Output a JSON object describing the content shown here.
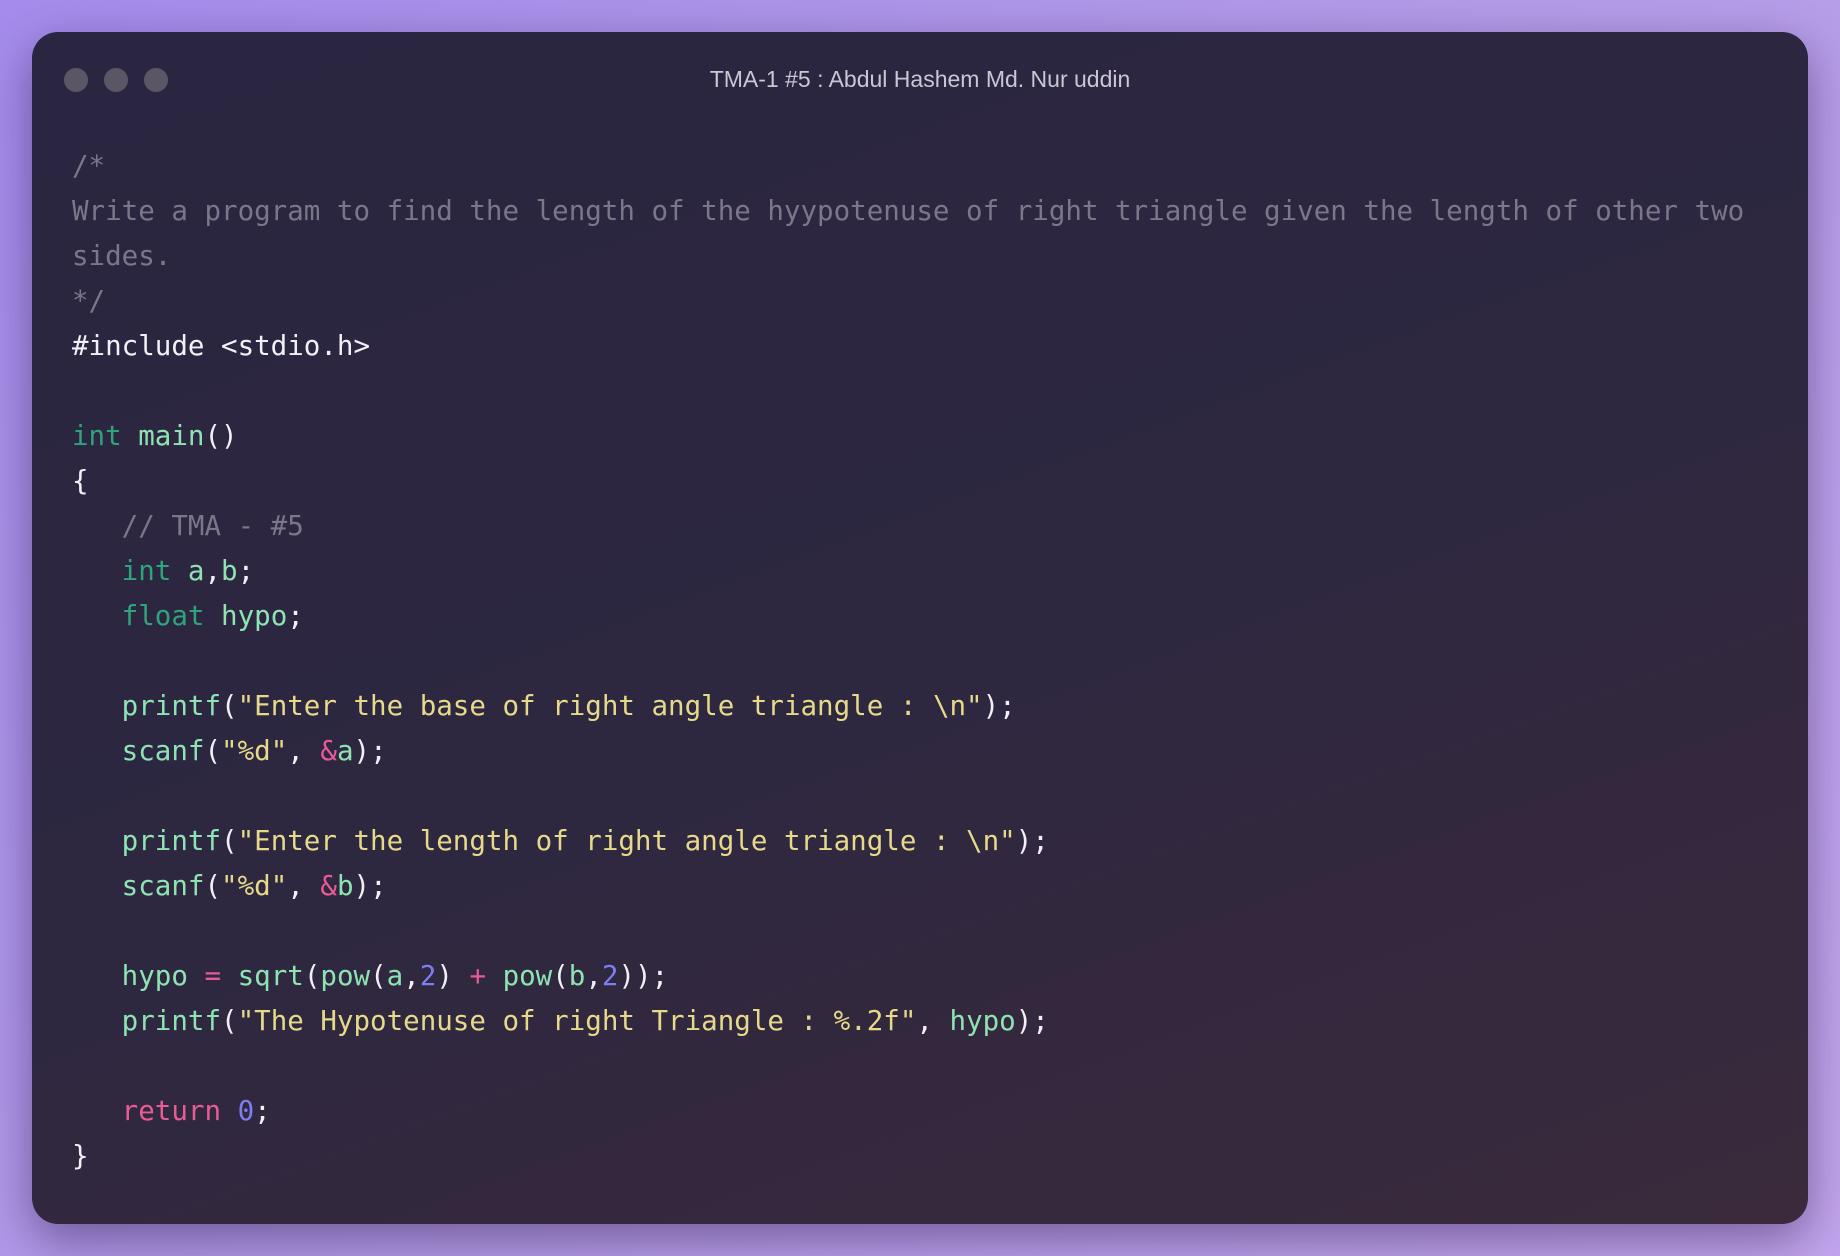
{
  "window": {
    "title": "TMA-1 #5 : Abdul Hashem Md. Nur uddin",
    "dot_color": "#5a5666"
  },
  "code": {
    "lines": [
      [
        {
          "t": "/*",
          "c": "cmt"
        }
      ],
      [
        {
          "t": "Write a program to find the length of the hyypotenuse of right triangle given the length of other two sides.",
          "c": "cmt"
        }
      ],
      [
        {
          "t": "*/",
          "c": "cmt"
        }
      ],
      [
        {
          "t": "#include <stdio.h>",
          "c": "pp"
        }
      ],
      [],
      [
        {
          "t": "int",
          "c": "type"
        },
        {
          "t": " ",
          "c": "punc"
        },
        {
          "t": "main",
          "c": "fn"
        },
        {
          "t": "()",
          "c": "punc"
        }
      ],
      [
        {
          "t": "{",
          "c": "punc"
        }
      ],
      [
        {
          "t": "   // TMA - #5",
          "c": "cmt"
        }
      ],
      [
        {
          "t": "   ",
          "c": "punc"
        },
        {
          "t": "int",
          "c": "type"
        },
        {
          "t": " ",
          "c": "punc"
        },
        {
          "t": "a",
          "c": "var"
        },
        {
          "t": ",",
          "c": "punc"
        },
        {
          "t": "b",
          "c": "var"
        },
        {
          "t": ";",
          "c": "punc"
        }
      ],
      [
        {
          "t": "   ",
          "c": "punc"
        },
        {
          "t": "float",
          "c": "type"
        },
        {
          "t": " ",
          "c": "punc"
        },
        {
          "t": "hypo",
          "c": "var"
        },
        {
          "t": ";",
          "c": "punc"
        }
      ],
      [],
      [
        {
          "t": "   ",
          "c": "punc"
        },
        {
          "t": "printf",
          "c": "fn"
        },
        {
          "t": "(",
          "c": "punc"
        },
        {
          "t": "\"Enter the base of right angle triangle : \\n\"",
          "c": "str"
        },
        {
          "t": ");",
          "c": "punc"
        }
      ],
      [
        {
          "t": "   ",
          "c": "punc"
        },
        {
          "t": "scanf",
          "c": "fn"
        },
        {
          "t": "(",
          "c": "punc"
        },
        {
          "t": "\"%d\"",
          "c": "str"
        },
        {
          "t": ", ",
          "c": "punc"
        },
        {
          "t": "&",
          "c": "op"
        },
        {
          "t": "a",
          "c": "var"
        },
        {
          "t": ");",
          "c": "punc"
        }
      ],
      [],
      [
        {
          "t": "   ",
          "c": "punc"
        },
        {
          "t": "printf",
          "c": "fn"
        },
        {
          "t": "(",
          "c": "punc"
        },
        {
          "t": "\"Enter the length of right angle triangle : \\n\"",
          "c": "str"
        },
        {
          "t": ");",
          "c": "punc"
        }
      ],
      [
        {
          "t": "   ",
          "c": "punc"
        },
        {
          "t": "scanf",
          "c": "fn"
        },
        {
          "t": "(",
          "c": "punc"
        },
        {
          "t": "\"%d\"",
          "c": "str"
        },
        {
          "t": ", ",
          "c": "punc"
        },
        {
          "t": "&",
          "c": "op"
        },
        {
          "t": "b",
          "c": "var"
        },
        {
          "t": ");",
          "c": "punc"
        }
      ],
      [],
      [
        {
          "t": "   ",
          "c": "punc"
        },
        {
          "t": "hypo",
          "c": "var"
        },
        {
          "t": " ",
          "c": "punc"
        },
        {
          "t": "=",
          "c": "op"
        },
        {
          "t": " ",
          "c": "punc"
        },
        {
          "t": "sqrt",
          "c": "fn"
        },
        {
          "t": "(",
          "c": "punc"
        },
        {
          "t": "pow",
          "c": "fn"
        },
        {
          "t": "(",
          "c": "punc"
        },
        {
          "t": "a",
          "c": "var"
        },
        {
          "t": ",",
          "c": "punc"
        },
        {
          "t": "2",
          "c": "num"
        },
        {
          "t": ") ",
          "c": "punc"
        },
        {
          "t": "+",
          "c": "op"
        },
        {
          "t": " ",
          "c": "punc"
        },
        {
          "t": "pow",
          "c": "fn"
        },
        {
          "t": "(",
          "c": "punc"
        },
        {
          "t": "b",
          "c": "var"
        },
        {
          "t": ",",
          "c": "punc"
        },
        {
          "t": "2",
          "c": "num"
        },
        {
          "t": "));",
          "c": "punc"
        }
      ],
      [
        {
          "t": "   ",
          "c": "punc"
        },
        {
          "t": "printf",
          "c": "fn"
        },
        {
          "t": "(",
          "c": "punc"
        },
        {
          "t": "\"The Hypotenuse of right Triangle : %.2f\"",
          "c": "str"
        },
        {
          "t": ", ",
          "c": "punc"
        },
        {
          "t": "hypo",
          "c": "var"
        },
        {
          "t": ");",
          "c": "punc"
        }
      ],
      [],
      [
        {
          "t": "   ",
          "c": "punc"
        },
        {
          "t": "return",
          "c": "kw"
        },
        {
          "t": " ",
          "c": "punc"
        },
        {
          "t": "0",
          "c": "num"
        },
        {
          "t": ";",
          "c": "punc"
        }
      ],
      [
        {
          "t": "}",
          "c": "punc"
        }
      ]
    ]
  }
}
